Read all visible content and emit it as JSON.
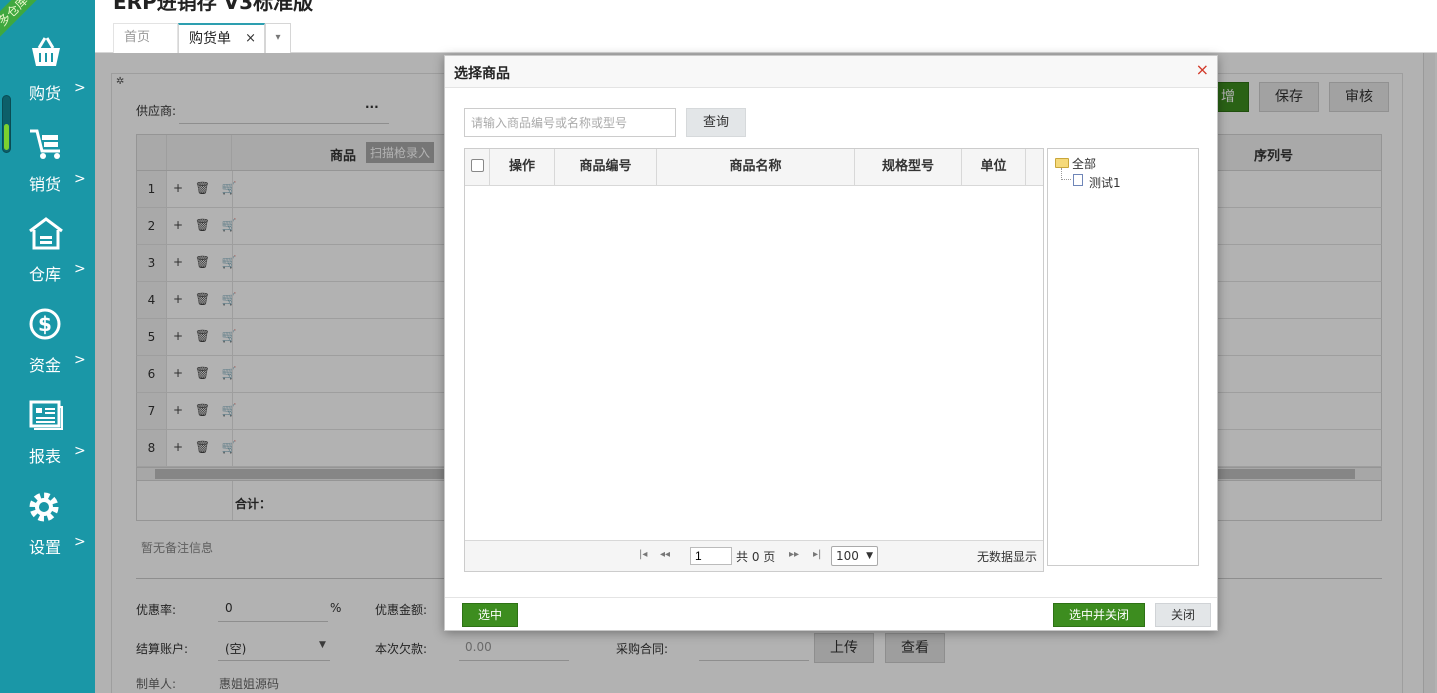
{
  "app": {
    "title": "ERP进销存 V3标准版",
    "ribbon": "多仓库"
  },
  "sidebar": {
    "items": [
      {
        "label": "购货",
        "icon": "basket-icon"
      },
      {
        "label": "销货",
        "icon": "cart-icon"
      },
      {
        "label": "仓库",
        "icon": "warehouse-icon"
      },
      {
        "label": "资金",
        "icon": "dollar-icon"
      },
      {
        "label": "报表",
        "icon": "report-icon"
      },
      {
        "label": "设置",
        "icon": "gear-icon"
      }
    ],
    "chevron": ">"
  },
  "tabs": {
    "home": "首页",
    "active": "购货单",
    "close": "×",
    "more": "▾"
  },
  "background": {
    "supplier_label": "供应商:",
    "supplier_more": "···",
    "buttons": {
      "new": "增",
      "save": "保存",
      "audit": "审核"
    },
    "grid_header_goods": "商品",
    "scan_label": "扫描枪录入",
    "grid_header_serial": "序列号",
    "rows": [
      "1",
      "2",
      "3",
      "4",
      "5",
      "6",
      "7",
      "8"
    ],
    "row_ops": "+ 🗑 🛒",
    "total_label": "合计：",
    "remark_placeholder": "暂无备注信息",
    "discount_rate_label": "优惠率:",
    "discount_rate_value": "0",
    "percent": "%",
    "discount_amount_label": "优惠金额:",
    "account_label": "结算账户:",
    "account_value": "(空)",
    "debt_label": "本次欠款:",
    "debt_value": "0.00",
    "contract_label": "采购合同:",
    "upload_btn": "上传",
    "view_btn": "查看",
    "maker_label": "制单人:",
    "maker_value": "惠姐姐源码"
  },
  "modal": {
    "title": "选择商品",
    "close": "×",
    "search_placeholder": "请输入商品编号或名称或型号",
    "search_button": "查询",
    "columns": [
      "操作",
      "商品编号",
      "商品名称",
      "规格型号",
      "单位"
    ],
    "pager": {
      "first": "|◂",
      "prev": "◂◂",
      "page_value": "1",
      "total_text": "共 0 页",
      "next": "▸▸",
      "last": "▸|",
      "page_size": "100",
      "empty_text": "无数据显示"
    },
    "tree": {
      "root": "全部",
      "children": [
        "测试1"
      ]
    },
    "footer": {
      "select": "选中",
      "select_close": "选中并关闭",
      "close": "关闭"
    }
  }
}
